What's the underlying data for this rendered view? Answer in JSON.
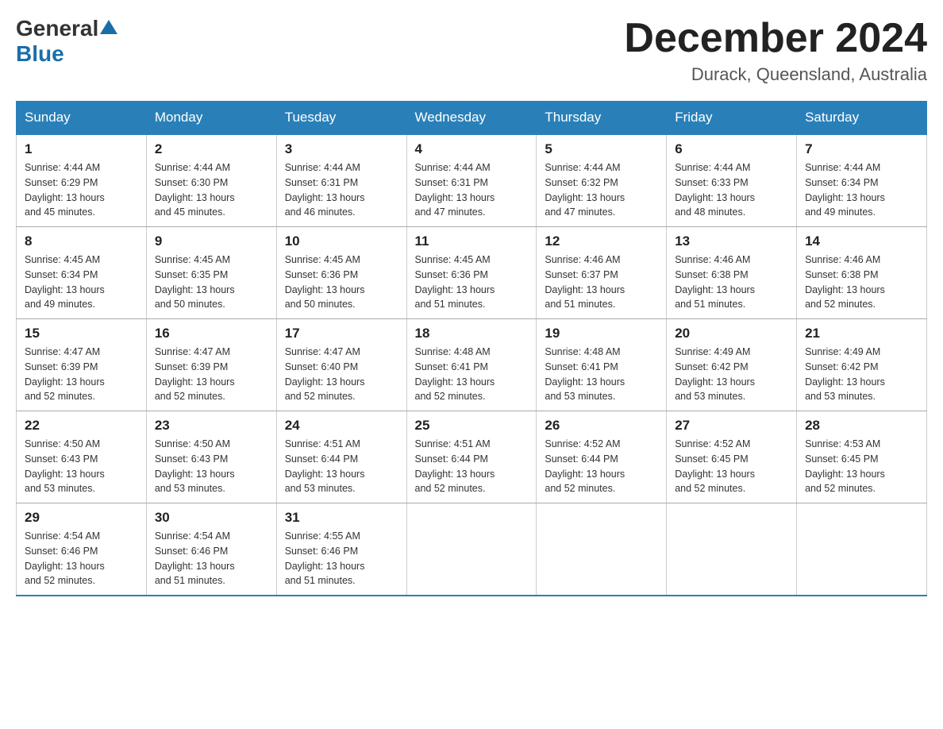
{
  "header": {
    "logo_general": "General",
    "logo_blue": "Blue",
    "month_title": "December 2024",
    "location": "Durack, Queensland, Australia"
  },
  "days_of_week": [
    "Sunday",
    "Monday",
    "Tuesday",
    "Wednesday",
    "Thursday",
    "Friday",
    "Saturday"
  ],
  "weeks": [
    [
      {
        "day": "1",
        "sunrise": "4:44 AM",
        "sunset": "6:29 PM",
        "daylight": "13 hours and 45 minutes."
      },
      {
        "day": "2",
        "sunrise": "4:44 AM",
        "sunset": "6:30 PM",
        "daylight": "13 hours and 45 minutes."
      },
      {
        "day": "3",
        "sunrise": "4:44 AM",
        "sunset": "6:31 PM",
        "daylight": "13 hours and 46 minutes."
      },
      {
        "day": "4",
        "sunrise": "4:44 AM",
        "sunset": "6:31 PM",
        "daylight": "13 hours and 47 minutes."
      },
      {
        "day": "5",
        "sunrise": "4:44 AM",
        "sunset": "6:32 PM",
        "daylight": "13 hours and 47 minutes."
      },
      {
        "day": "6",
        "sunrise": "4:44 AM",
        "sunset": "6:33 PM",
        "daylight": "13 hours and 48 minutes."
      },
      {
        "day": "7",
        "sunrise": "4:44 AM",
        "sunset": "6:34 PM",
        "daylight": "13 hours and 49 minutes."
      }
    ],
    [
      {
        "day": "8",
        "sunrise": "4:45 AM",
        "sunset": "6:34 PM",
        "daylight": "13 hours and 49 minutes."
      },
      {
        "day": "9",
        "sunrise": "4:45 AM",
        "sunset": "6:35 PM",
        "daylight": "13 hours and 50 minutes."
      },
      {
        "day": "10",
        "sunrise": "4:45 AM",
        "sunset": "6:36 PM",
        "daylight": "13 hours and 50 minutes."
      },
      {
        "day": "11",
        "sunrise": "4:45 AM",
        "sunset": "6:36 PM",
        "daylight": "13 hours and 51 minutes."
      },
      {
        "day": "12",
        "sunrise": "4:46 AM",
        "sunset": "6:37 PM",
        "daylight": "13 hours and 51 minutes."
      },
      {
        "day": "13",
        "sunrise": "4:46 AM",
        "sunset": "6:38 PM",
        "daylight": "13 hours and 51 minutes."
      },
      {
        "day": "14",
        "sunrise": "4:46 AM",
        "sunset": "6:38 PM",
        "daylight": "13 hours and 52 minutes."
      }
    ],
    [
      {
        "day": "15",
        "sunrise": "4:47 AM",
        "sunset": "6:39 PM",
        "daylight": "13 hours and 52 minutes."
      },
      {
        "day": "16",
        "sunrise": "4:47 AM",
        "sunset": "6:39 PM",
        "daylight": "13 hours and 52 minutes."
      },
      {
        "day": "17",
        "sunrise": "4:47 AM",
        "sunset": "6:40 PM",
        "daylight": "13 hours and 52 minutes."
      },
      {
        "day": "18",
        "sunrise": "4:48 AM",
        "sunset": "6:41 PM",
        "daylight": "13 hours and 52 minutes."
      },
      {
        "day": "19",
        "sunrise": "4:48 AM",
        "sunset": "6:41 PM",
        "daylight": "13 hours and 53 minutes."
      },
      {
        "day": "20",
        "sunrise": "4:49 AM",
        "sunset": "6:42 PM",
        "daylight": "13 hours and 53 minutes."
      },
      {
        "day": "21",
        "sunrise": "4:49 AM",
        "sunset": "6:42 PM",
        "daylight": "13 hours and 53 minutes."
      }
    ],
    [
      {
        "day": "22",
        "sunrise": "4:50 AM",
        "sunset": "6:43 PM",
        "daylight": "13 hours and 53 minutes."
      },
      {
        "day": "23",
        "sunrise": "4:50 AM",
        "sunset": "6:43 PM",
        "daylight": "13 hours and 53 minutes."
      },
      {
        "day": "24",
        "sunrise": "4:51 AM",
        "sunset": "6:44 PM",
        "daylight": "13 hours and 53 minutes."
      },
      {
        "day": "25",
        "sunrise": "4:51 AM",
        "sunset": "6:44 PM",
        "daylight": "13 hours and 52 minutes."
      },
      {
        "day": "26",
        "sunrise": "4:52 AM",
        "sunset": "6:44 PM",
        "daylight": "13 hours and 52 minutes."
      },
      {
        "day": "27",
        "sunrise": "4:52 AM",
        "sunset": "6:45 PM",
        "daylight": "13 hours and 52 minutes."
      },
      {
        "day": "28",
        "sunrise": "4:53 AM",
        "sunset": "6:45 PM",
        "daylight": "13 hours and 52 minutes."
      }
    ],
    [
      {
        "day": "29",
        "sunrise": "4:54 AM",
        "sunset": "6:46 PM",
        "daylight": "13 hours and 52 minutes."
      },
      {
        "day": "30",
        "sunrise": "4:54 AM",
        "sunset": "6:46 PM",
        "daylight": "13 hours and 51 minutes."
      },
      {
        "day": "31",
        "sunrise": "4:55 AM",
        "sunset": "6:46 PM",
        "daylight": "13 hours and 51 minutes."
      },
      null,
      null,
      null,
      null
    ]
  ],
  "labels": {
    "sunrise": "Sunrise:",
    "sunset": "Sunset:",
    "daylight": "Daylight:"
  }
}
